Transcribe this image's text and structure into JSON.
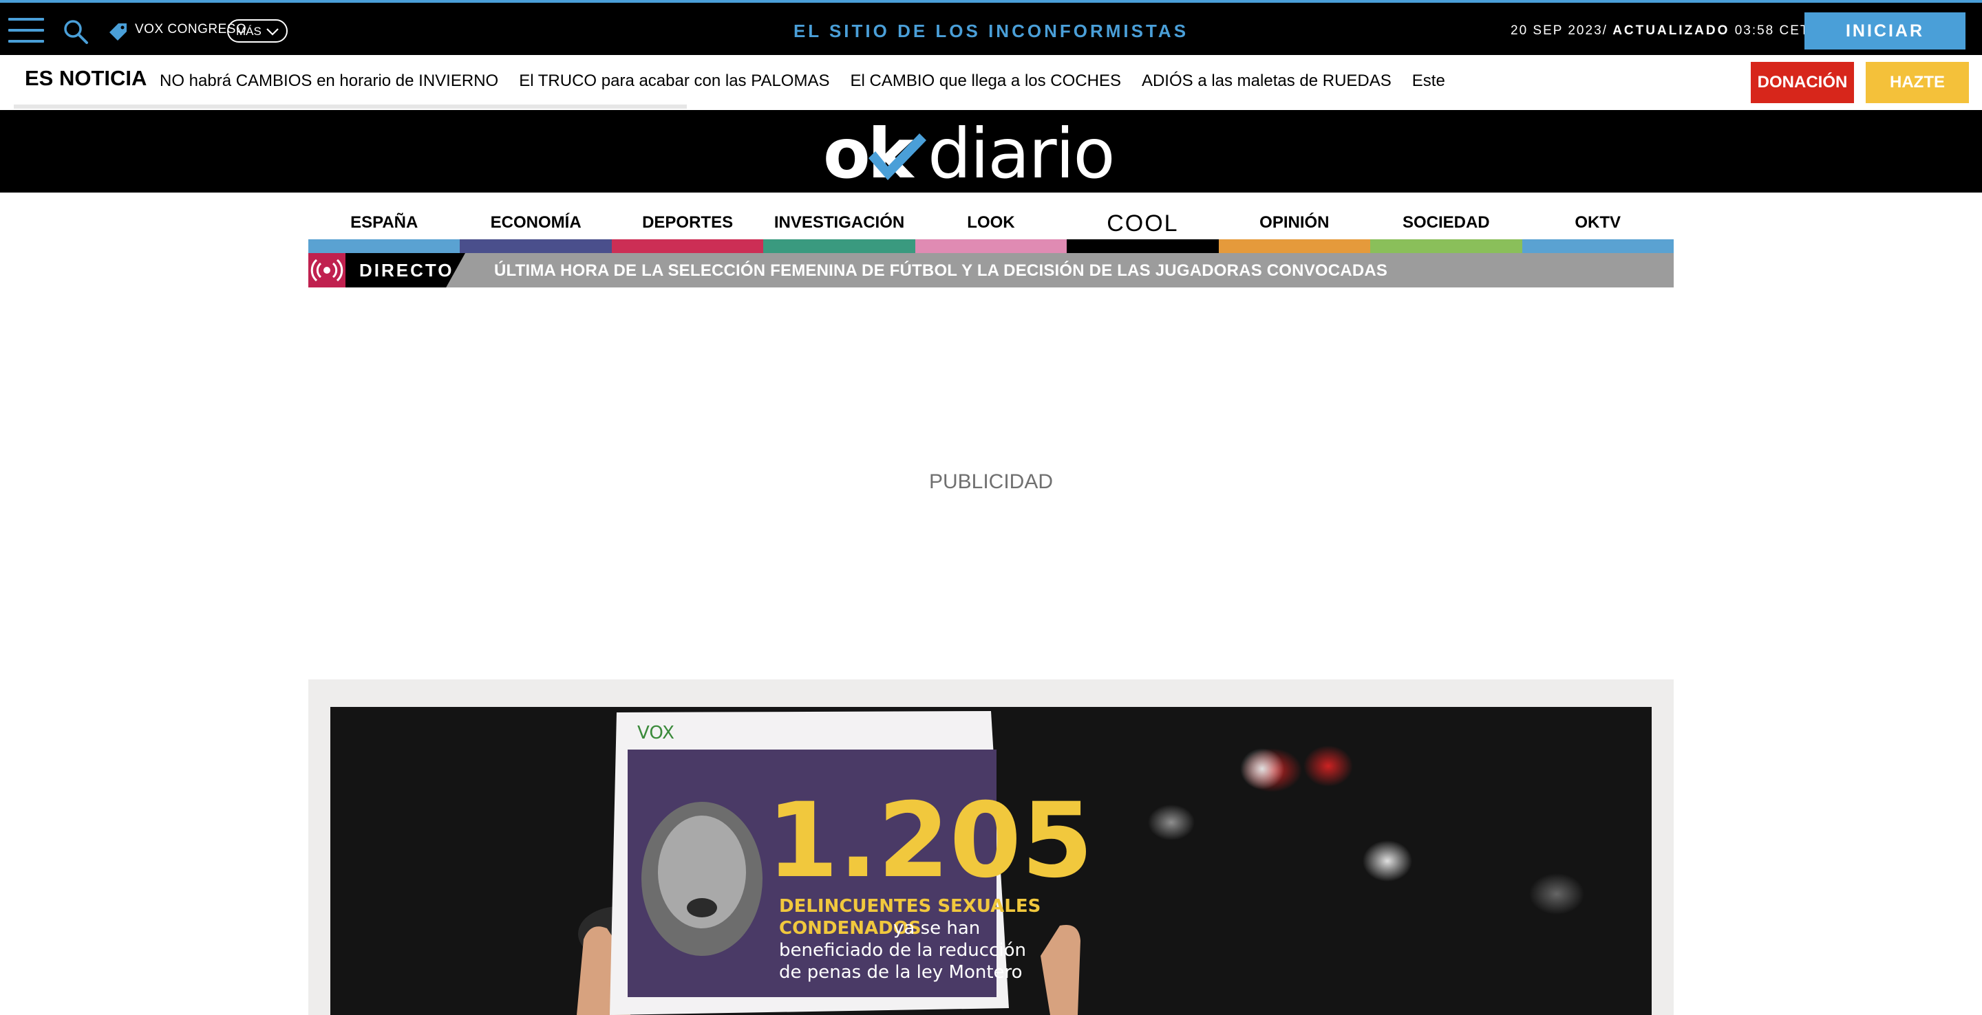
{
  "topbar": {
    "tag_label": "VOX CONGRESO",
    "more_label": "MÁS",
    "slogan": "EL SITIO DE LOS INCONFORMISTAS",
    "date": "20 SEP 2023/",
    "updated_label": "ACTUALIZADO",
    "updated_time": "03:58 CET",
    "login_label": "INICIAR SESIÓN",
    "accent_color": "#4a9fd8"
  },
  "ticker": {
    "title": "ES NOTICIA",
    "items": [
      "NO habrá CAMBIOS en horario de INVIERNO",
      "El TRUCO para acabar con las PALOMAS",
      "El CAMBIO que llega a los COCHES",
      "ADIÓS a las maletas de RUEDAS",
      "Este"
    ],
    "donate_label": "DONACIÓN",
    "member_label": "HAZTE SOCIO"
  },
  "logo": {
    "text_left": "ok",
    "text_right": "diario"
  },
  "nav": {
    "items": [
      {
        "label": "ESPAÑA",
        "color": "#5aa2d2"
      },
      {
        "label": "ECONOMÍA",
        "color": "#4a4f8c"
      },
      {
        "label": "DEPORTES",
        "color": "#cc2e55"
      },
      {
        "label": "INVESTIGACIÓN",
        "color": "#3a9a7f"
      },
      {
        "label": "LOOK",
        "color": "#e08bb3"
      },
      {
        "label": "COOL",
        "color": "#000000"
      },
      {
        "label": "OPINIÓN",
        "color": "#e59a3b"
      },
      {
        "label": "SOCIEDAD",
        "color": "#8abf5a"
      },
      {
        "label": "OKTV",
        "color": "#5aa2d2"
      }
    ]
  },
  "live": {
    "badge": "DIRECTO",
    "headline": "ÚLTIMA HORA DE LA SELECCIÓN FEMENINA DE FÚTBOL Y LA DECISIÓN DE LAS JUGADORAS CONVOCADAS"
  },
  "ad": {
    "label": "PUBLICIDAD"
  },
  "feature": {
    "sign_brand": "VOX",
    "sign_number": "1.205",
    "sign_line1": "DELINCUENTES SEXUALES",
    "sign_line2": "CONDENADOS",
    "sign_line2b": "ya se han",
    "sign_line3": "beneficiado de la reducción",
    "sign_line4": "de penas de la ley Montero"
  }
}
